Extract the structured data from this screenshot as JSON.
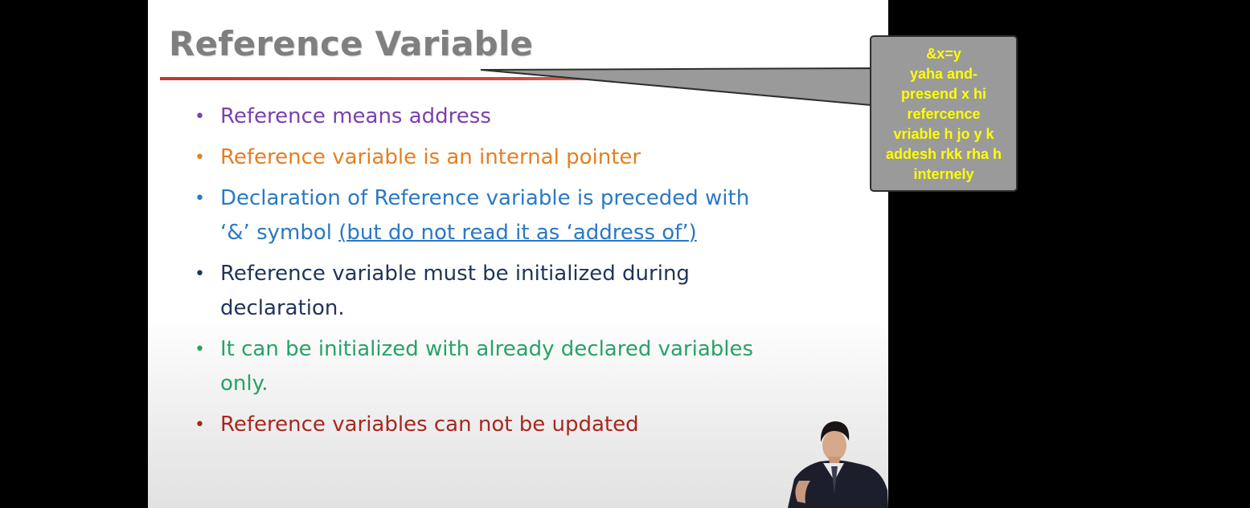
{
  "slide": {
    "title": "Reference Variable",
    "bullets": [
      {
        "lines": [
          "Reference means address"
        ],
        "color": "#7b3fae"
      },
      {
        "lines": [
          "Reference variable is an internal pointer"
        ],
        "color": "#e67e22"
      },
      {
        "text_before": "Declaration of Reference variable is preceded with",
        "text_mid": "‘&’ symbol ",
        "text_underlined": "(but do not read it as ‘address of’)",
        "color": "#2b78c4"
      },
      {
        "lines": [
          "Reference variable must be initialized during",
          "declaration."
        ],
        "color": "#1f3458"
      },
      {
        "lines": [
          "It can be initialized with already declared variables",
          "only."
        ],
        "color": "#27a268"
      },
      {
        "lines": [
          "Reference variables can not be updated"
        ],
        "color": "#a9261e"
      }
    ],
    "title_rule_color": "#c0392b"
  },
  "annotation": {
    "lines": [
      "&x=y",
      "yaha and-",
      "presend x hi",
      "refercence",
      "vriable h jo y k",
      "addesh rkk rha h",
      "internely"
    ],
    "text_color": "#ffff00",
    "background": "#9a9a9a"
  }
}
